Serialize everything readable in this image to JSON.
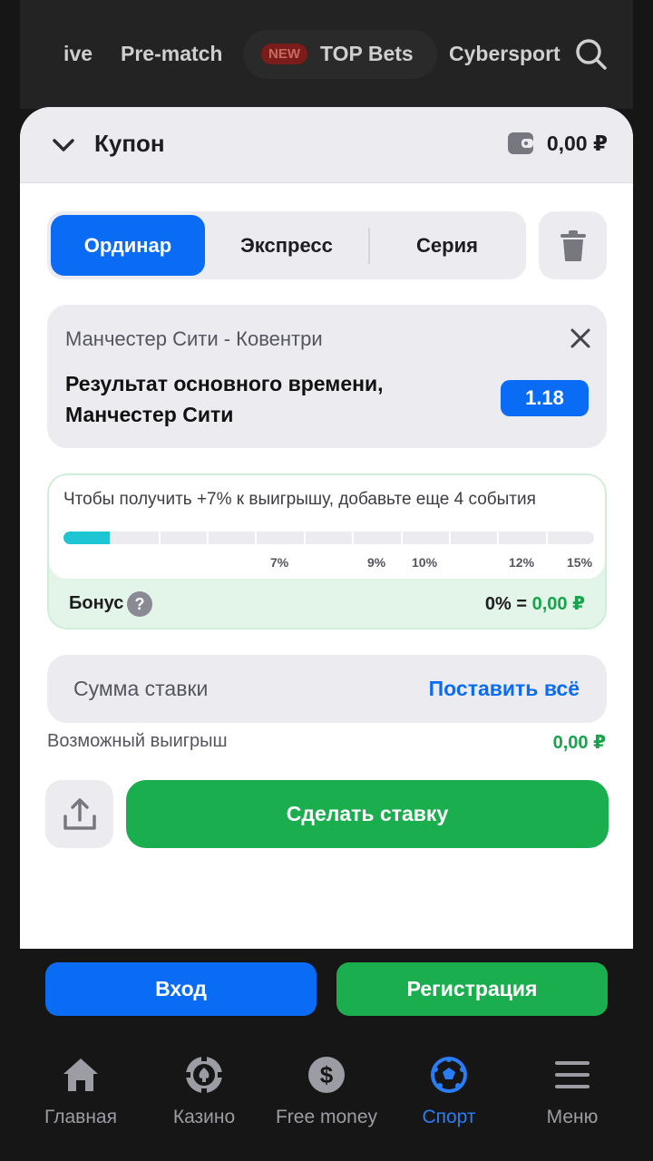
{
  "topnav": {
    "items": [
      "Live",
      "Pre-match",
      "TOP Bets",
      "Cybersport"
    ],
    "new_badge": "NEW"
  },
  "coupon": {
    "title": "Купон",
    "balance": "0,00 ₽"
  },
  "tabs": [
    {
      "label": "Ординар",
      "active": true
    },
    {
      "label": "Экспресс",
      "active": false
    },
    {
      "label": "Серия",
      "active": false
    }
  ],
  "bet": {
    "match": "Манчестер Сити - Ковентри",
    "outcome": "Результат основного времени, Манчестер Сити",
    "odds": "1.18"
  },
  "bonus": {
    "message": "Чтобы получить +7% к выигрышу, добавьте еще 4 события",
    "progress_segments": 11,
    "progress_filled": 1,
    "percent_marks": [
      "7%",
      "9%",
      "10%",
      "12%",
      "15%"
    ],
    "label": "Бонус",
    "value_prefix": "0% =",
    "value_amount": "0,00 ₽"
  },
  "stake": {
    "placeholder": "Сумма ставки",
    "all_label": "Поставить всё",
    "win_label": "Возможный выигрыш",
    "win_value": "0,00 ₽"
  },
  "place_bet_label": "Сделать ставку",
  "auth": {
    "login": "Вход",
    "register": "Регистрация"
  },
  "bottom_nav": [
    {
      "label": "Главная",
      "icon": "home-icon",
      "active": false
    },
    {
      "label": "Казино",
      "icon": "casino-chip-icon",
      "active": false
    },
    {
      "label": "Free money",
      "icon": "dollar-coin-icon",
      "active": false
    },
    {
      "label": "Спорт",
      "icon": "soccer-ball-icon",
      "active": true
    },
    {
      "label": "Меню",
      "icon": "menu-icon",
      "active": false
    }
  ],
  "colors": {
    "primary": "#0a6cf5",
    "success": "#1aae4f",
    "progress": "#1ec6d3"
  }
}
